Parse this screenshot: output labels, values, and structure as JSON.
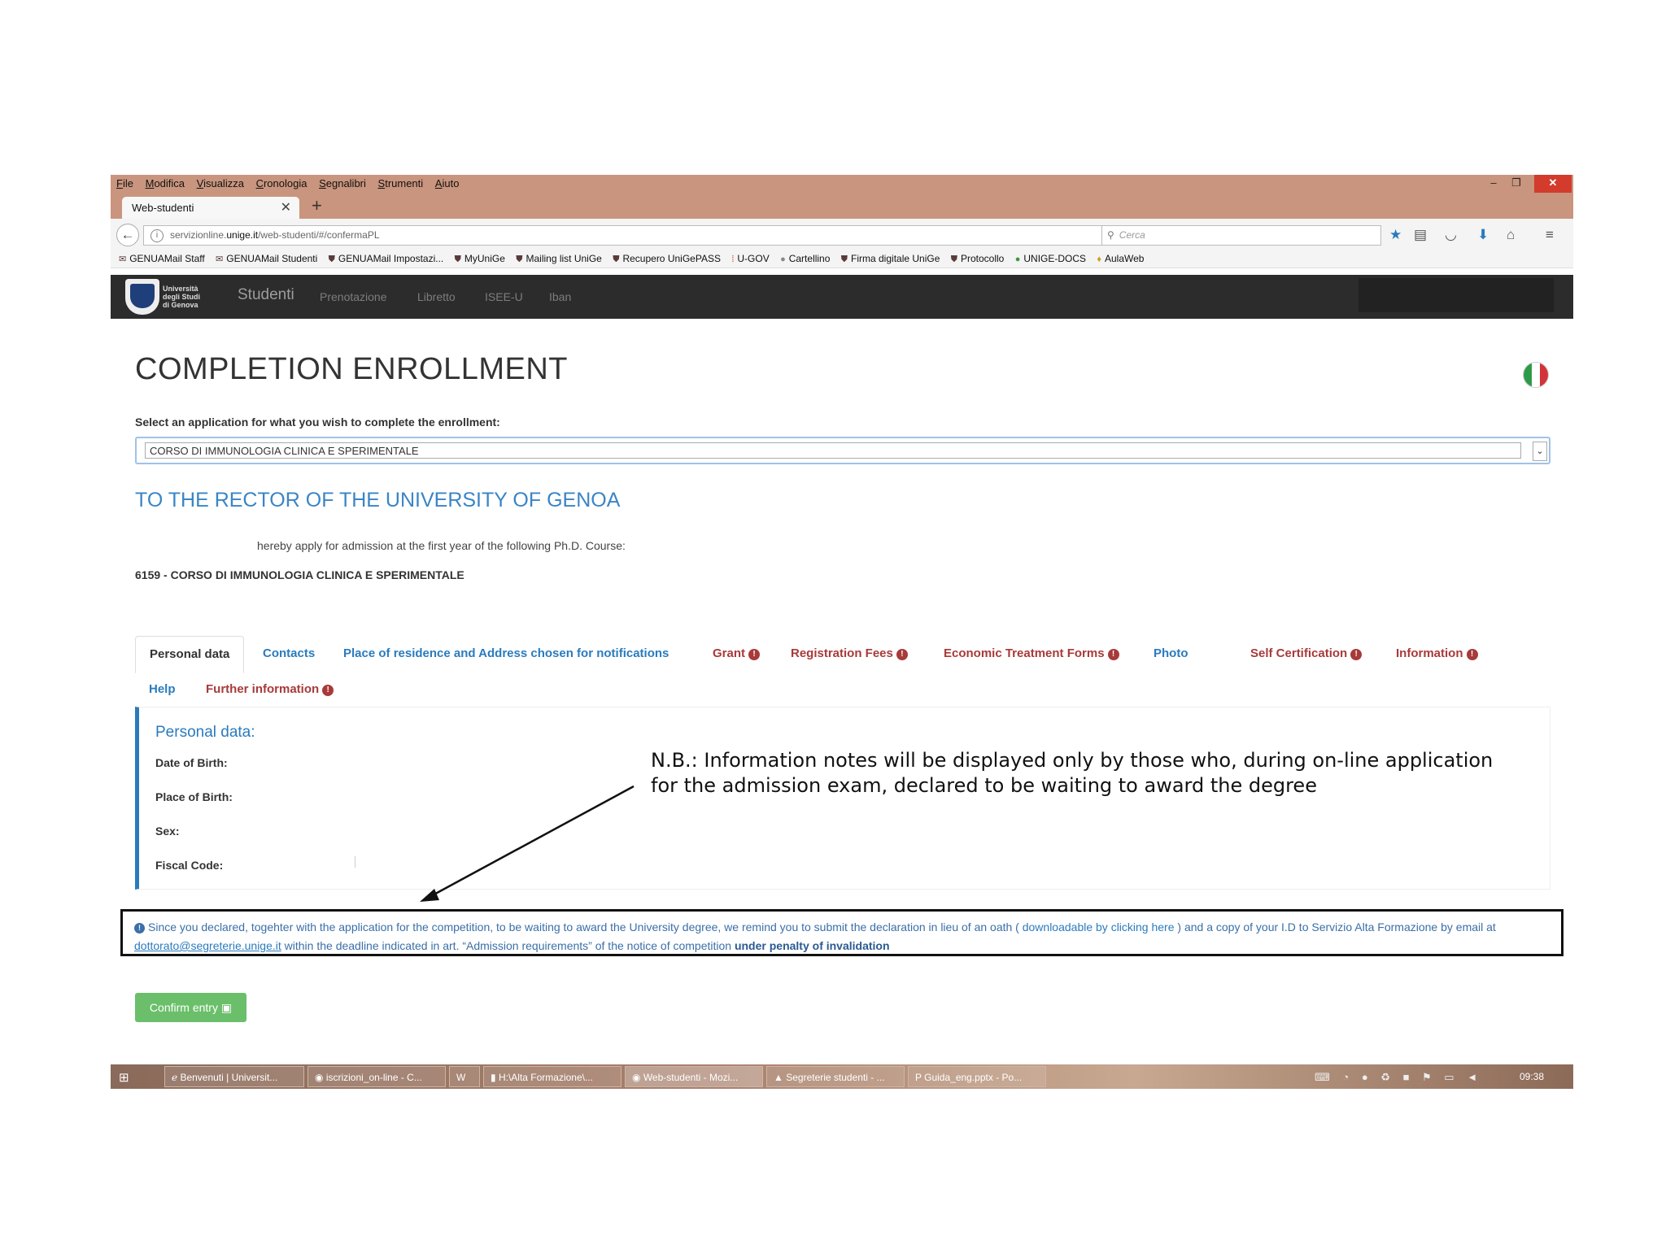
{
  "browser": {
    "menu": [
      "File",
      "Modifica",
      "Visualizza",
      "Cronologia",
      "Segnalibri",
      "Strumenti",
      "Aiuto"
    ],
    "tab_title": "Web-studenti",
    "url_prefix": "servizionline.",
    "url_host": "unige.it",
    "url_path": "/web-studenti/#/confermaPL",
    "search_placeholder": "Cerca",
    "bookmarks": [
      "GENUAMail Staff",
      "GENUAMail Studenti",
      "GENUAMail Impostazi...",
      "MyUniGe",
      "Mailing list UniGe",
      "Recupero UniGePASS",
      "U-GOV",
      "Cartellino",
      "Firma digitale UniGe",
      "Protocollo",
      "UNIGE-DOCS",
      "AulaWeb"
    ]
  },
  "app": {
    "logo_text": [
      "Università",
      "degli Studi",
      "di Genova"
    ],
    "brand": "Studenti",
    "nav": [
      "Prenotazione",
      "Libretto",
      "ISEE-U",
      "Iban"
    ]
  },
  "page": {
    "title": "COMPLETION ENROLLMENT",
    "select_label": "Select an application for what you wish to complete the enrollment:",
    "select_value": "CORSO DI IMMUNOLOGIA CLINICA E SPERIMENTALE",
    "rector_heading": "TO THE RECTOR OF THE UNIVERSITY OF GENOA",
    "apply_text": "hereby apply for admission at the first year of the following Ph.D. Course:",
    "course": "6159 - CORSO DI IMMUNOLOGIA CLINICA E SPERIMENTALE"
  },
  "tabs": {
    "personal": "Personal data",
    "contacts": "Contacts",
    "residence": "Place of residence and Address chosen for notifications",
    "grant": "Grant",
    "fees": "Registration Fees",
    "economic": "Economic Treatment Forms",
    "photo": "Photo",
    "selfcert": "Self Certification",
    "information": "Information",
    "help": "Help",
    "further": "Further information"
  },
  "panel": {
    "heading": "Personal data:",
    "dob": "Date of Birth:",
    "pob": "Place of Birth:",
    "sex": "Sex:",
    "fiscal": "Fiscal Code:"
  },
  "annotation": "N.B.: Information notes will be displayed only by those who, during on-line application for the admission exam, declared to be waiting to award the degree",
  "notice": {
    "part1": "Since you declared, togehter with the application for the competition, to be waiting to award the University degree, we remind you to submit the declaration in lieu of an oath ( ",
    "link1": "downloadable by clicking here",
    "part2": " ) and a copy of your I.D to Servizio Alta Formazione by email at ",
    "email": "dottorato@segreterie.unige.it",
    "part3": " within the deadline indicated in art. “Admission requirements” of the notice of competition ",
    "bold": "under penalty of invalidation"
  },
  "confirm_label": "Confirm entry",
  "taskbar": {
    "items": [
      "Benvenuti | Universit...",
      "iscrizioni_on-line - C...",
      "",
      "H:\\Alta Formazione\\...",
      "Web-studenti - Mozi...",
      "Segreterie studenti - ...",
      "Guida_eng.pptx - Po..."
    ],
    "clock": "09:38"
  },
  "colors": {
    "accent": "#2a7bbd",
    "alert": "#a83a3a",
    "navbar": "#2c2c2c",
    "confirm": "#6bbf6b"
  }
}
